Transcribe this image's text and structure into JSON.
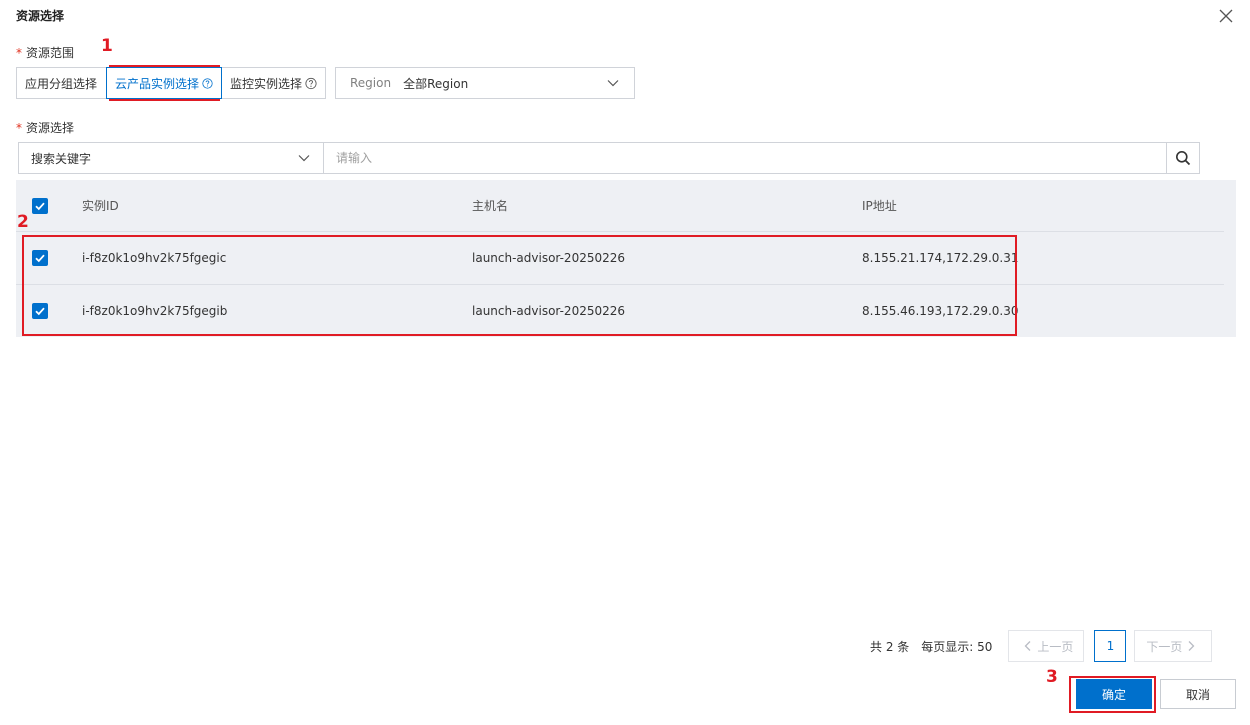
{
  "dialog": {
    "title": "资源选择"
  },
  "resource_scope": {
    "label": "资源范围",
    "segments": [
      "应用分组选择",
      "云产品实例选择",
      "监控实例选择"
    ],
    "active_index": 1,
    "region": {
      "prefix": "Region",
      "value": "全部Region"
    }
  },
  "resource_select": {
    "label": "资源选择",
    "search_key": "搜索关键字",
    "search_placeholder": "请输入"
  },
  "table": {
    "columns": [
      "实例ID",
      "主机名",
      "IP地址"
    ],
    "rows": [
      {
        "id": "i-f8z0k1o9hv2k75fgegic",
        "host": "launch-advisor-20250226",
        "ip": "8.155.21.174,172.29.0.31",
        "checked": true
      },
      {
        "id": "i-f8z0k1o9hv2k75fgegib",
        "host": "launch-advisor-20250226",
        "ip": "8.155.46.193,172.29.0.30",
        "checked": true
      }
    ],
    "all_checked": true
  },
  "pagination": {
    "total": "共 2 条",
    "per_page": "每页显示: 50",
    "prev": "上一页",
    "current": "1",
    "next": "下一页"
  },
  "footer": {
    "ok": "确定",
    "cancel": "取消"
  },
  "annotations": {
    "step1": "1",
    "step2": "2",
    "step3": "3"
  },
  "colors": {
    "primary": "#0070cc",
    "annotation_red": "#e01b24",
    "table_bg": "#eef0f4"
  }
}
